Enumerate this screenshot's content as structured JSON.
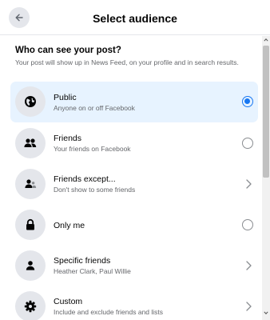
{
  "header": {
    "title": "Select audience",
    "back_icon": "arrow-left-icon"
  },
  "section": {
    "heading": "Who can see your post?",
    "description": "Your post will show up in News Feed, on your profile and in search results."
  },
  "options": [
    {
      "label": "Public",
      "sublabel": "Anyone on or off Facebook",
      "icon": "globe-icon",
      "control": "radio",
      "selected": true
    },
    {
      "label": "Friends",
      "sublabel": "Your friends on Facebook",
      "icon": "friends-icon",
      "control": "radio",
      "selected": false
    },
    {
      "label": "Friends except...",
      "sublabel": "Don't show to some friends",
      "icon": "friends-except-icon",
      "control": "chevron",
      "selected": false
    },
    {
      "label": "Only me",
      "sublabel": "",
      "icon": "lock-icon",
      "control": "radio",
      "selected": false
    },
    {
      "label": "Specific friends",
      "sublabel": "Heather Clark, Paul Willie",
      "icon": "person-icon",
      "control": "chevron",
      "selected": false
    },
    {
      "label": "Custom",
      "sublabel": "Include and exclude friends and lists",
      "icon": "gear-icon",
      "control": "chevron",
      "selected": false
    }
  ],
  "colors": {
    "accent": "#1877f2",
    "selected_bg": "#e7f3ff",
    "icon_bg": "#e4e6eb",
    "secondary_text": "#65676b"
  }
}
